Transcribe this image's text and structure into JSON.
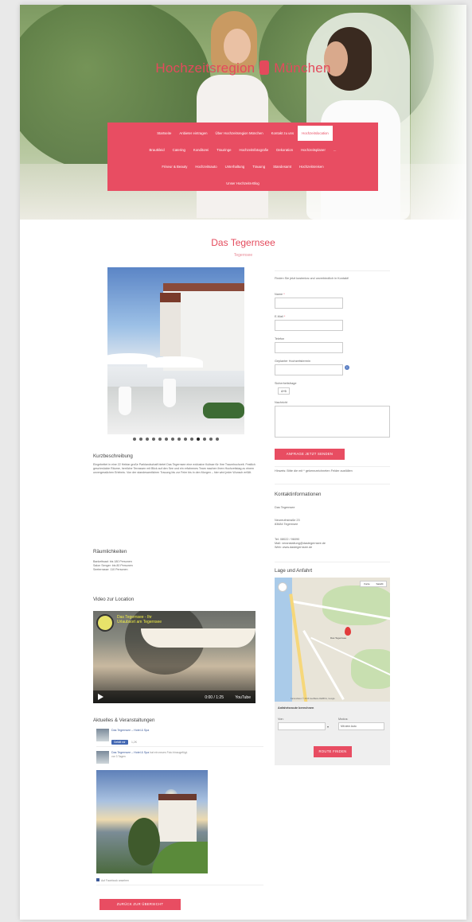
{
  "site": {
    "title_left": "Hochzeitsregion",
    "title_right": "München"
  },
  "nav": {
    "rows": [
      [
        "Startseite",
        "Anbieter eintragen",
        "Über Hochzeitsregion München",
        "Kontakt zu uns",
        "Hochzeitslocation"
      ],
      [
        "Brautkleid",
        "Catering",
        "Konditorei",
        "Trauringe",
        "Hochzeitsfotografie",
        "Dekoration",
        "Hochzeitsplaner",
        "..."
      ],
      [
        "Friseur & Beauty",
        "Hochzeitsauto",
        "Unterhaltung",
        "Trauung",
        "Standesamt",
        "Hochzeitsreisen"
      ],
      [
        "Unser Hochzeits-Blog"
      ]
    ],
    "active": "Hochzeitslocation"
  },
  "page": {
    "title": "Das Tegernsee",
    "subtitle": "Tegernsee"
  },
  "gallery": {
    "dot_count": 14,
    "active_index": 10
  },
  "sections": {
    "short_description_heading": "Kurzbeschreibung",
    "short_description": "Eingebettet in eine 22 Hektar große Parklandschaft bietet Das Tegernsee eine exklusive Kulisse für Ihre Traumhochzeit. Festlich geschmückte Räume, herrliche Terrassen mit Blick auf den See und ein erfahrenes Team machen Ihren Hochzeitstag zu einem unvergesslichen Erlebnis. Von der standesamtlichen Trauung bis zur Feier bis in den Morgen – hier wird jeder Wunsch erfüllt.",
    "rooms_heading": "Räumlichkeiten",
    "rooms": [
      "Bankettsaal: bis 180 Personen",
      "Salon Senger: bis 80 Personen",
      "Seeterrasse: 110 Personen"
    ],
    "video_heading": "Video zur Location",
    "news_heading": "Aktuelles & Veranstaltungen",
    "back_button": "ZURÜCK ZUR ÜBERSICHT"
  },
  "video": {
    "title": "Das Tegernsee - Ihr Urlaubsort am Tegernsee",
    "time": "0:00 / 1:25",
    "brand": "YouTube"
  },
  "facebook": {
    "page_name": "Das Tegernsee – Hotel & Spa",
    "like_label": "Gefällt mir",
    "like_count": "1,2K",
    "post_author": "Das Tegernsee – Hotel & Spa",
    "post_text": "hat ein neues Foto hinzugefügt.",
    "post_time": "vor 3 Tagen",
    "footer": "Auf Facebook ansehen"
  },
  "form": {
    "intro": "Finden Sie jetzt kostenlos und unverbindlich in Kontakt!",
    "name_label": "Name",
    "email_label": "E-Mail",
    "phone_label": "Telefon",
    "date_label": "Geplanter Hochzeitstermin",
    "captcha_label": "Sicherheitsfrage",
    "captcha_value": "4+5",
    "message_label": "Nachricht",
    "submit": "ANFRAGE JETZT SENDEN",
    "required_note": "Hinweis: Bitte die mit * gekennzeichneten Felder ausfüllen"
  },
  "contact": {
    "heading": "Kontaktinformationen",
    "name": "Das Tegernsee",
    "street": "Neureuthstraße 23",
    "city": "83684 Tegernsee",
    "phone": "Tel: 08022 / 96090",
    "mail": "Mail: veranstaltung@dastegernsee.de",
    "web": "Web: www.dastegernsee.de"
  },
  "map": {
    "heading": "Lage und Anfahrt",
    "type_map": "Karte",
    "type_sat": "Satellit",
    "place": "Das Tegernsee",
    "copyright": "Kartendaten © 2016 GeoBasis-DE/BKG, Google"
  },
  "route": {
    "heading": "Anfahrtsroute berechnen",
    "from_label": "Von:",
    "mode_label": "Modus:",
    "mode_value": "Mit dem Auto",
    "submit": "ROUTE FINDEN"
  },
  "colors": {
    "accent": "#e84d62"
  }
}
